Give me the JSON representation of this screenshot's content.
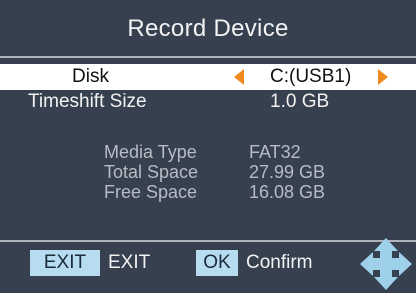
{
  "header": {
    "title": "Record Device"
  },
  "settings": {
    "disk": {
      "label": "Disk",
      "value": "C:(USB1)"
    },
    "timeshift": {
      "label": "Timeshift Size",
      "value": "1.0 GB"
    }
  },
  "disk_info": {
    "media_type": {
      "label": "Media Type",
      "value": "FAT32"
    },
    "total_space": {
      "label": "Total Space",
      "value": "27.99 GB"
    },
    "free_space": {
      "label": "Free Space",
      "value": "16.08 GB"
    }
  },
  "footer": {
    "exit_key": "EXIT",
    "exit_label": "EXIT",
    "ok_key": "OK",
    "ok_label": "Confirm"
  },
  "icons": {
    "left_arrow": "left-arrow-icon",
    "right_arrow": "right-arrow-icon",
    "navigation": "navigation-dpad-icon"
  },
  "colors": {
    "background": "#36404f",
    "highlight": "#ffffff",
    "arrow": "#f08a1e",
    "key_box": "#b7dcef",
    "info_text": "#b7bcc4"
  }
}
